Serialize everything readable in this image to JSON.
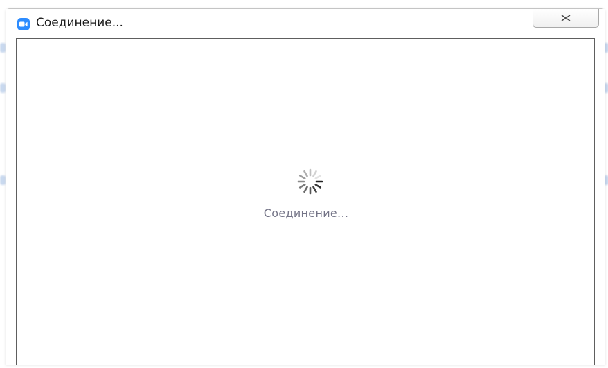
{
  "window": {
    "title": "Соединение..."
  },
  "icons": {
    "app": "zoom-camera-icon",
    "close": "close-icon",
    "spinner": "loading-spinner-icon"
  },
  "content": {
    "status_text": "Соединение..."
  },
  "colors": {
    "app_icon": "#2d8cff",
    "status_text": "#747487",
    "spinner": "#222222"
  }
}
